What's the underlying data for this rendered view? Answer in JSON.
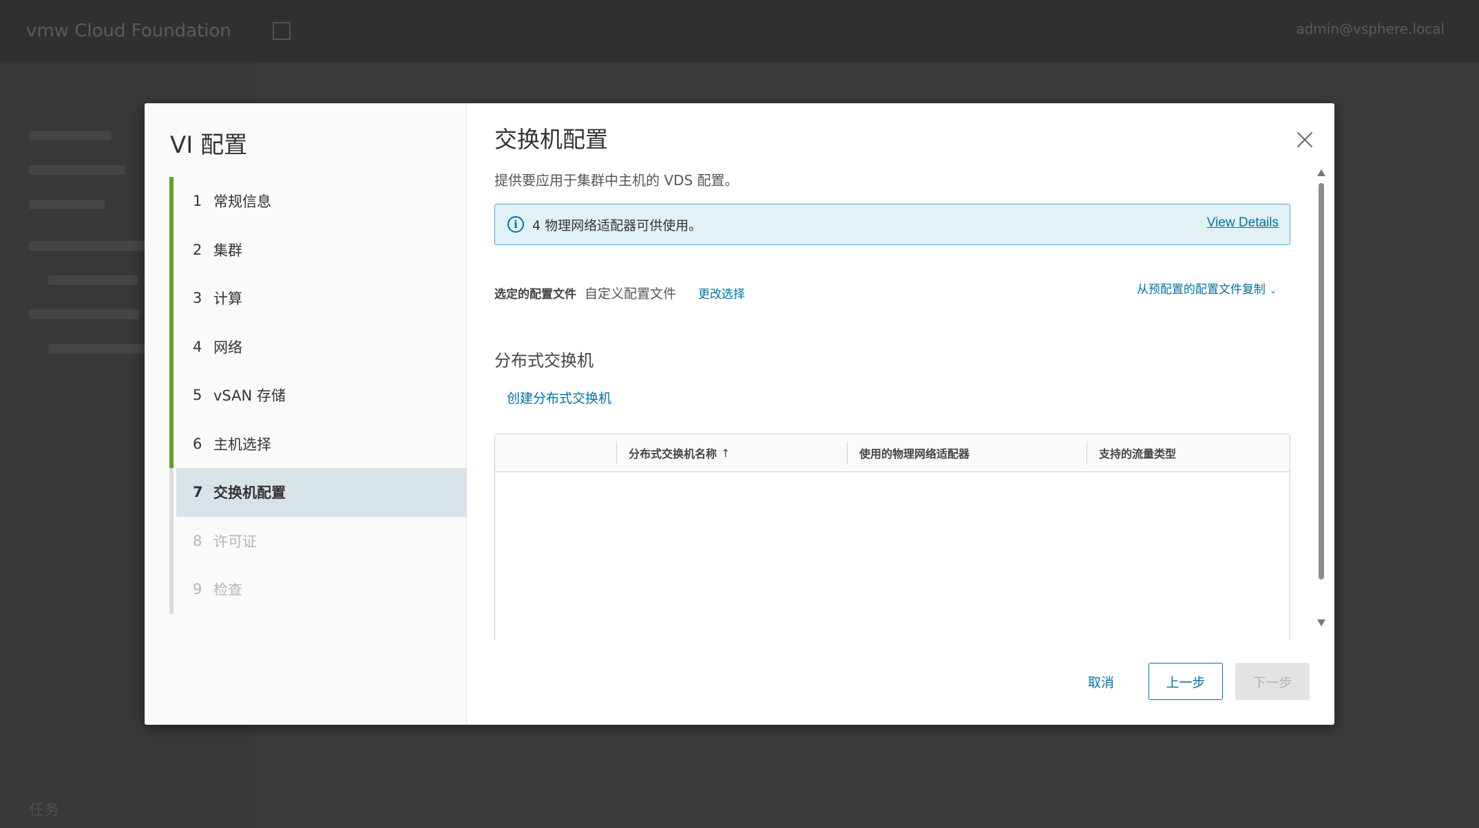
{
  "app": {
    "title": "vmw Cloud Foundation",
    "user": "admin@vsphere.local",
    "tasks_label": "任务"
  },
  "wizard": {
    "title": "VI 配置",
    "steps": [
      {
        "num": "1",
        "label": "常规信息"
      },
      {
        "num": "2",
        "label": "集群"
      },
      {
        "num": "3",
        "label": "计算"
      },
      {
        "num": "4",
        "label": "网络"
      },
      {
        "num": "5",
        "label": "vSAN 存储"
      },
      {
        "num": "6",
        "label": "主机选择"
      },
      {
        "num": "7",
        "label": "交换机配置"
      },
      {
        "num": "8",
        "label": "许可证"
      },
      {
        "num": "9",
        "label": "检查"
      }
    ],
    "active_step": 7
  },
  "page": {
    "title": "交换机配置",
    "description": "提供要应用于集群中主机的 VDS 配置。",
    "info": {
      "text": "4 物理网络适配器可供使用。",
      "link": "View Details"
    },
    "profile": {
      "label": "选定的配置文件",
      "value": "自定义配置文件",
      "change_link": "更改选择",
      "copy_link": "从预配置的配置文件复制"
    },
    "section_title": "分布式交换机",
    "create_link": "创建分布式交换机",
    "grid": {
      "columns": [
        "分布式交换机名称",
        "使用的物理网络适配器",
        "支持的流量类型"
      ],
      "sort_indicator": "↑",
      "rows": []
    }
  },
  "footer": {
    "cancel": "取消",
    "back": "上一步",
    "next": "下一步"
  },
  "colors": {
    "accent": "#0072a3",
    "done_step": "#62a420",
    "active_step_bg": "#d8e3e9",
    "info_bg": "#e1f1f6",
    "info_border": "#49afd9"
  }
}
